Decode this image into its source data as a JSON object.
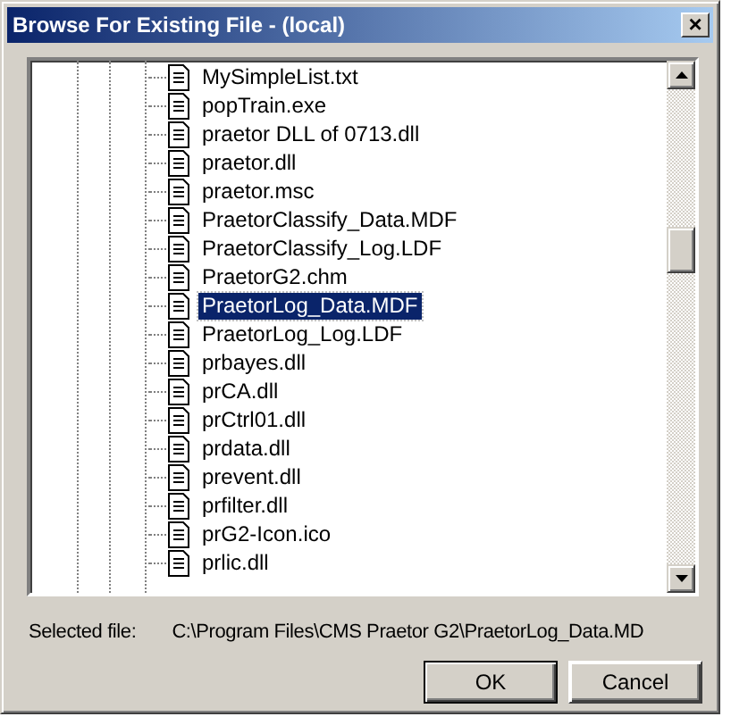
{
  "window": {
    "title": "Browse For Existing File - (local)",
    "close": "×"
  },
  "tree": {
    "items": [
      {
        "name": "MySimpleList.txt",
        "selected": false
      },
      {
        "name": "popTrain.exe",
        "selected": false
      },
      {
        "name": "praetor DLL of 0713.dll",
        "selected": false
      },
      {
        "name": "praetor.dll",
        "selected": false
      },
      {
        "name": "praetor.msc",
        "selected": false
      },
      {
        "name": "PraetorClassify_Data.MDF",
        "selected": false
      },
      {
        "name": "PraetorClassify_Log.LDF",
        "selected": false
      },
      {
        "name": "PraetorG2.chm",
        "selected": false
      },
      {
        "name": "PraetorLog_Data.MDF",
        "selected": true
      },
      {
        "name": "PraetorLog_Log.LDF",
        "selected": false
      },
      {
        "name": "prbayes.dll",
        "selected": false
      },
      {
        "name": "prCA.dll",
        "selected": false
      },
      {
        "name": "prCtrl01.dll",
        "selected": false
      },
      {
        "name": "prdata.dll",
        "selected": false
      },
      {
        "name": "prevent.dll",
        "selected": false
      },
      {
        "name": "prfilter.dll",
        "selected": false
      },
      {
        "name": "prG2-Icon.ico",
        "selected": false
      },
      {
        "name": "prlic.dll",
        "selected": false
      }
    ]
  },
  "selected_file": {
    "label": "Selected file:",
    "value": "C:\\Program Files\\CMS Praetor G2\\PraetorLog_Data.MD"
  },
  "buttons": [
    {
      "label": "OK",
      "default": true
    },
    {
      "label": "Cancel",
      "default": false
    }
  ]
}
